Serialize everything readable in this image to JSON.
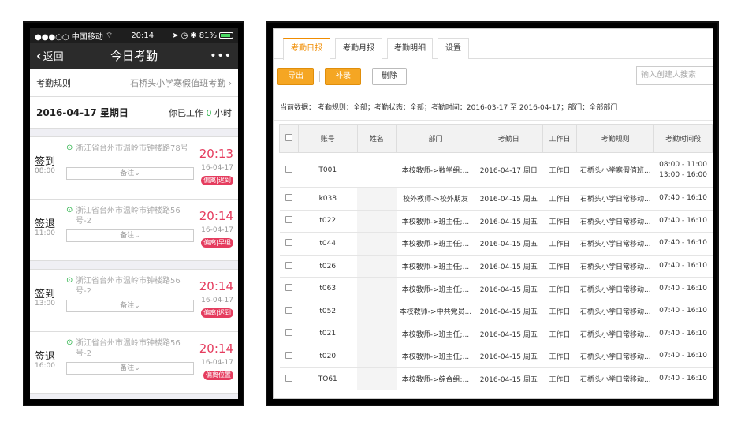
{
  "phone": {
    "status": {
      "carrier": "●●●○○ 中国移动",
      "time": "20:14",
      "battery": "81%"
    },
    "nav": {
      "back": "返回",
      "title": "今日考勤",
      "more": "•••"
    },
    "rule": {
      "label": "考勤规则",
      "value": "石桥头小学寒假值班考勤"
    },
    "summary": {
      "date": "2016-04-17 星期日",
      "work_prefix": "你已工作",
      "hours": "0",
      "work_suffix": "小时"
    },
    "records": [
      {
        "type": "签到",
        "scheduled": "08:00",
        "address": "浙江省台州市温岭市钟楼路78号",
        "note": "备注",
        "clock": "20:13",
        "date": "16-04-17",
        "badge": "偏离|迟到"
      },
      {
        "type": "签退",
        "scheduled": "11:00",
        "address": "浙江省台州市温岭市钟楼路56号-2",
        "note": "备注",
        "clock": "20:14",
        "date": "16-04-17",
        "badge": "偏离|早退"
      },
      {
        "type": "签到",
        "scheduled": "13:00",
        "address": "浙江省台州市温岭市钟楼路56号-2",
        "note": "备注",
        "clock": "20:14",
        "date": "16-04-17",
        "badge": "偏离|迟到"
      },
      {
        "type": "签退",
        "scheduled": "16:00",
        "address": "浙江省台州市温岭市钟楼路56号-2",
        "note": "备注",
        "clock": "20:14",
        "date": "16-04-17",
        "badge": "偏离位置"
      }
    ]
  },
  "web": {
    "tabs": [
      "考勤日报",
      "考勤月报",
      "考勤明细",
      "设置"
    ],
    "buttons": {
      "export": "导出",
      "supplement": "补录",
      "delete": "删除"
    },
    "search_placeholder": "输入创建人搜索",
    "filters": "当前数据： 考勤规则：全部；考勤状态：全部；考勤时间：2016-03-17 至 2016-04-17；部门：全部部门",
    "columns": [
      "账号",
      "姓名",
      "部门",
      "考勤日",
      "工作日",
      "考勤规则",
      "考勤时间段"
    ],
    "rows": [
      {
        "account": "T001",
        "name": "",
        "dept": "本校教师->数学组;...",
        "day": "2016-04-17 周日",
        "workday": "工作日",
        "rule": "石桥头小学寒假值班...",
        "period": "08:00 - 11:00",
        "period2": "13:00 - 16:00"
      },
      {
        "account": "k038",
        "name": "",
        "dept": "校外教师->校外朋友",
        "day": "2016-04-15 周五",
        "workday": "工作日",
        "rule": "石桥头小学日常移动...",
        "period": "07:40 - 16:10"
      },
      {
        "account": "t022",
        "name": "",
        "dept": "本校教师->班主任;...",
        "day": "2016-04-15 周五",
        "workday": "工作日",
        "rule": "石桥头小学日常移动...",
        "period": "07:40 - 16:10"
      },
      {
        "account": "t044",
        "name": "",
        "dept": "本校教师->班主任;...",
        "day": "2016-04-15 周五",
        "workday": "工作日",
        "rule": "石桥头小学日常移动...",
        "period": "07:40 - 16:10"
      },
      {
        "account": "t026",
        "name": "",
        "dept": "本校教师->班主任;...",
        "day": "2016-04-15 周五",
        "workday": "工作日",
        "rule": "石桥头小学日常移动...",
        "period": "07:40 - 16:10"
      },
      {
        "account": "t063",
        "name": "",
        "dept": "本校教师->班主任;...",
        "day": "2016-04-15 周五",
        "workday": "工作日",
        "rule": "石桥头小学日常移动...",
        "period": "07:40 - 16:10"
      },
      {
        "account": "t052",
        "name": "",
        "dept": "本校教师->中共党员...",
        "day": "2016-04-15 周五",
        "workday": "工作日",
        "rule": "石桥头小学日常移动...",
        "period": "07:40 - 16:10"
      },
      {
        "account": "t021",
        "name": "",
        "dept": "本校教师->班主任;...",
        "day": "2016-04-15 周五",
        "workday": "工作日",
        "rule": "石桥头小学日常移动...",
        "period": "07:40 - 16:10"
      },
      {
        "account": "t020",
        "name": "",
        "dept": "本校教师->班主任;...",
        "day": "2016-04-15 周五",
        "workday": "工作日",
        "rule": "石桥头小学日常移动...",
        "period": "07:40 - 16:10"
      },
      {
        "account": "TO61",
        "name": "",
        "dept": "本校教师->综合组;...",
        "day": "2016-04-15 周五",
        "workday": "工作日",
        "rule": "石桥头小学日常移动...",
        "period": "07:40 - 16:10"
      }
    ]
  },
  "colors": {
    "accent": "#f5a623",
    "late": "#e53c5e",
    "ok": "#2db34a"
  }
}
